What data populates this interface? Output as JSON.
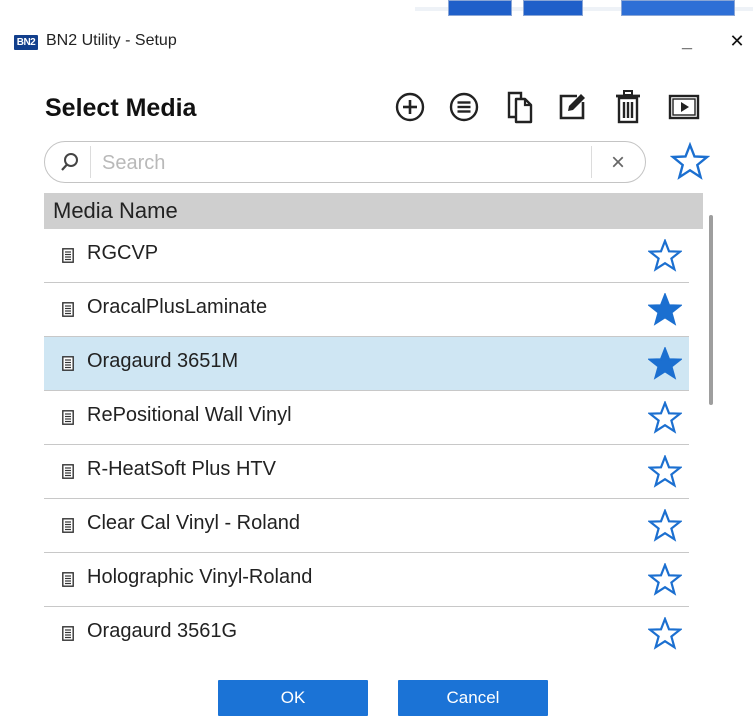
{
  "window": {
    "logo_text": "BN2",
    "title": "BN2 Utility - Setup",
    "minimize_label": "_",
    "close_label": "✕"
  },
  "heading": "Select Media",
  "toolbar": {
    "icons": [
      "add-circle-icon",
      "list-circle-icon",
      "copy-icon",
      "edit-icon",
      "delete-icon",
      "preview-icon"
    ]
  },
  "search": {
    "placeholder": "Search",
    "value": "",
    "clear_label": "×"
  },
  "list": {
    "header": "Media Name",
    "items": [
      {
        "name": "RGCVP",
        "favorite": false,
        "selected": false
      },
      {
        "name": "OracalPlusLaminate",
        "favorite": true,
        "selected": false
      },
      {
        "name": "Oragaurd 3651M",
        "favorite": true,
        "selected": true
      },
      {
        "name": "RePositional Wall Vinyl",
        "favorite": false,
        "selected": false
      },
      {
        "name": "R-HeatSoft Plus HTV",
        "favorite": false,
        "selected": false
      },
      {
        "name": "Clear Cal Vinyl - Roland",
        "favorite": false,
        "selected": false
      },
      {
        "name": "Holographic Vinyl-Roland",
        "favorite": false,
        "selected": false
      },
      {
        "name": "Oragaurd 3561G",
        "favorite": false,
        "selected": false
      }
    ]
  },
  "buttons": {
    "ok": "OK",
    "cancel": "Cancel"
  },
  "colors": {
    "accent": "#1b73d6",
    "star": "#1b6fd0",
    "selected_row": "#cfe6f3",
    "header_bg": "#cfcfcf"
  }
}
